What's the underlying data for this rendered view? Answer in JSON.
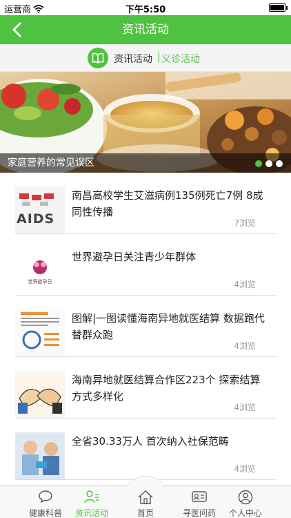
{
  "status_bar": {
    "carrier": "运营商",
    "time": "下午5:50"
  },
  "nav": {
    "title": "资讯活动"
  },
  "subtabs": {
    "tab1": "资讯活动",
    "separator": "|",
    "tab2": "义诊活动"
  },
  "banner": {
    "caption": "家庭营养的常见误区",
    "slide_count": 3,
    "active_slide": 1
  },
  "news": [
    {
      "headline": "南昌高校学生艾滋病例135例死亡7例 8成同性传播",
      "views": "7浏览",
      "thumb_text": "AIDS"
    },
    {
      "headline": "世界避孕日关注青少年群体",
      "views": "4浏览",
      "thumb_text": "世界避孕日"
    },
    {
      "headline": "图解|一图读懂海南异地就医结算 数据跑代替群众跑",
      "views": "4浏览"
    },
    {
      "headline": "海南异地就医结算合作区223个 探索结算方式多样化",
      "views": "4浏览"
    },
    {
      "headline": "全省30.33万人 首次纳入社保范畴",
      "views": "4浏览"
    }
  ],
  "tabbar": {
    "items": [
      {
        "label": "健康科普",
        "icon": "chat-bubble-icon"
      },
      {
        "label": "资讯活动",
        "icon": "person-list-icon"
      },
      {
        "label": "首页",
        "icon": "home-icon"
      },
      {
        "label": "寻医问药",
        "icon": "id-card-icon"
      },
      {
        "label": "个人中心",
        "icon": "user-icon"
      }
    ],
    "active": 1
  },
  "colors": {
    "accent": "#4fc242",
    "text": "#222222",
    "muted": "#999999"
  }
}
